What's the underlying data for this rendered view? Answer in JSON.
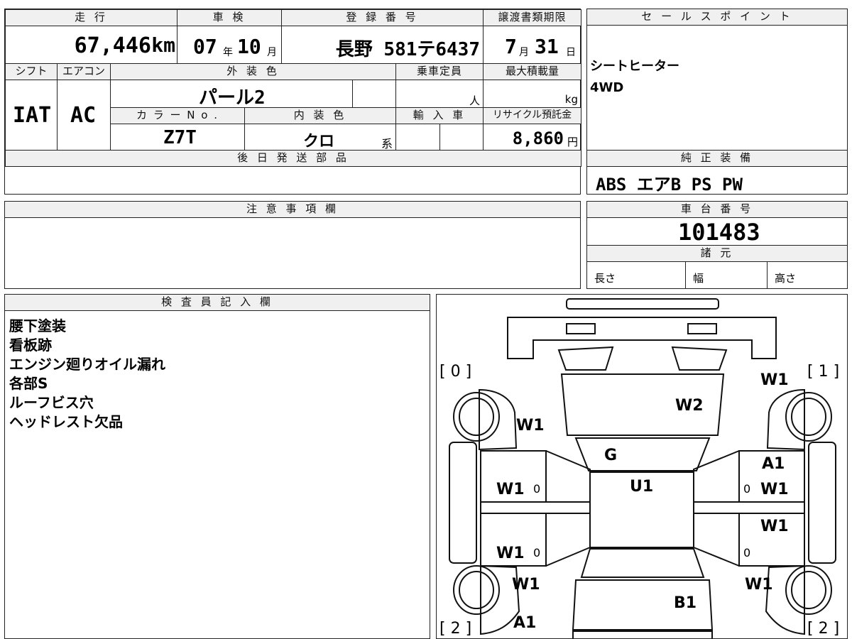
{
  "top": {
    "mileage": {
      "header": "走 行",
      "value": "67,446",
      "unit": "km"
    },
    "inspection": {
      "header": "車 検",
      "year": "07",
      "year_unit": "年",
      "month": "10",
      "month_unit": "月"
    },
    "registration": {
      "header": "登 録 番 号",
      "value": "長野 581テ6437"
    },
    "transfer_deadline": {
      "header": "譲渡書類期限",
      "month": "7",
      "month_unit": "月",
      "day": "31",
      "day_unit": "日"
    },
    "shift": {
      "header": "シフト",
      "value": "IAT"
    },
    "aircon": {
      "header": "エアコン",
      "value": "AC"
    },
    "exterior_color": {
      "header": "外 装 色",
      "value": "パール2"
    },
    "capacity": {
      "header": "乗車定員",
      "unit": "人"
    },
    "max_load": {
      "header": "最大積載量",
      "unit": "kg"
    },
    "color_no": {
      "header": "カ ラ ー N o .",
      "value": "Z7T"
    },
    "interior_color": {
      "header": "内 装 色",
      "value": "クロ",
      "suffix": "系"
    },
    "import": {
      "header": "輸 入 車"
    },
    "recycle": {
      "header": "リサイクル預託金",
      "value": "8,860",
      "unit": "円"
    },
    "later_parts": {
      "header": "後 日 発 送 部 品"
    }
  },
  "sales_points": {
    "header": "セ ー ル ス ポ イ ン ト",
    "items": [
      "シートヒーター",
      "4WD"
    ]
  },
  "standard_equipment": {
    "header": "純 正 装 備",
    "value": "ABS エアB PS PW"
  },
  "notes": {
    "header": "注 意 事 項 欄"
  },
  "chassis": {
    "header": "車 台 番 号",
    "value": "101483"
  },
  "specs": {
    "header": "諸 元",
    "length": "長さ",
    "width": "幅",
    "height": "高さ"
  },
  "inspector": {
    "header": "検 査 員 記 入 欄",
    "lines": [
      "腰下塗装",
      "看板跡",
      "エンジン廻りオイル漏れ",
      "各部S",
      "ルーフビス穴",
      "ヘッドレスト欠品"
    ]
  },
  "diagram": {
    "corners": [
      "[ 0 ]",
      "[ 1 ]",
      "[ 2 ]",
      "[ 2 ]"
    ],
    "marks": {
      "front_right_fender": "W1",
      "windshield": "W2",
      "front_left_fender": "W1",
      "hood_edge": "G",
      "roof": "U1",
      "front_right_door_a": "A1",
      "front_right_door_w": "W1",
      "front_left_door": "W1",
      "rear_right_door": "W1",
      "rear_left_door": "W1",
      "rear_left_quarter": "W1",
      "rear_right_quarter": "W1",
      "rear_glass": "B1",
      "rear_left_bumper": "A1",
      "door_zero": "0"
    }
  }
}
